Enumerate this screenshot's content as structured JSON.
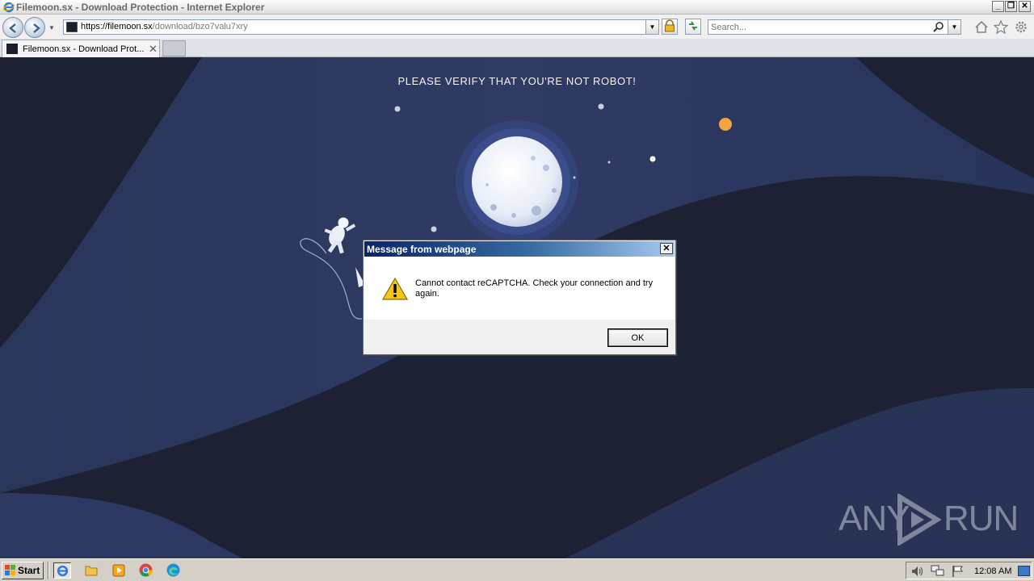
{
  "window": {
    "title": "Filemoon.sx - Download Protection - Internet Explorer"
  },
  "address_bar": {
    "url_host": "https://filemoon.sx",
    "url_path": "/download/bzo7valu7xry",
    "search_placeholder": "Search..."
  },
  "tabs": [
    {
      "label": "Filemoon.sx - Download Prot..."
    }
  ],
  "page": {
    "heading": "PLEASE VERIFY THAT YOU'RE NOT ROBOT!",
    "watermark_left": "ANY",
    "watermark_right": "RUN"
  },
  "dialog": {
    "title": "Message from webpage",
    "message": "Cannot contact reCAPTCHA. Check your connection and try again.",
    "ok_label": "OK"
  },
  "taskbar": {
    "start_label": "Start",
    "clock": "12:08 AM"
  },
  "colors": {
    "page_background": "#2b3657",
    "dark_wave": "#1c2133",
    "dialog_caption": "#0a246a",
    "planet": "#f2a541"
  }
}
